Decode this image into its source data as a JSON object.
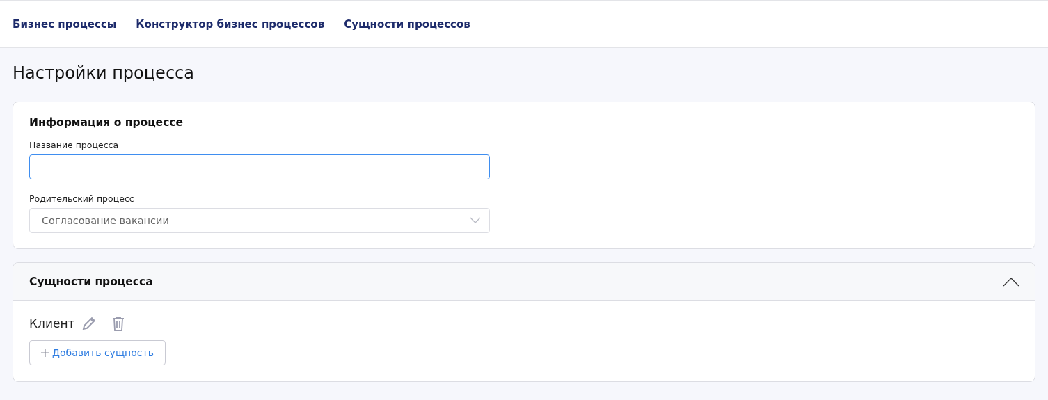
{
  "nav": [
    {
      "label": "Бизнес процессы"
    },
    {
      "label": "Конструктор бизнес процессов"
    },
    {
      "label": "Сущности процессов"
    }
  ],
  "page_title": "Настройки процесса",
  "info_card": {
    "title": "Информация о процессе",
    "name_field": {
      "label": "Название процесса",
      "focused": true
    },
    "parent_field": {
      "label": "Родительский процесс",
      "value": "Согласование вакансии",
      "disabled": true
    }
  },
  "entities_card": {
    "title": "Сущности процесса",
    "expanded": true,
    "entities": [
      {
        "name": "Клиент"
      }
    ],
    "add_button": "Добавить сущность"
  }
}
